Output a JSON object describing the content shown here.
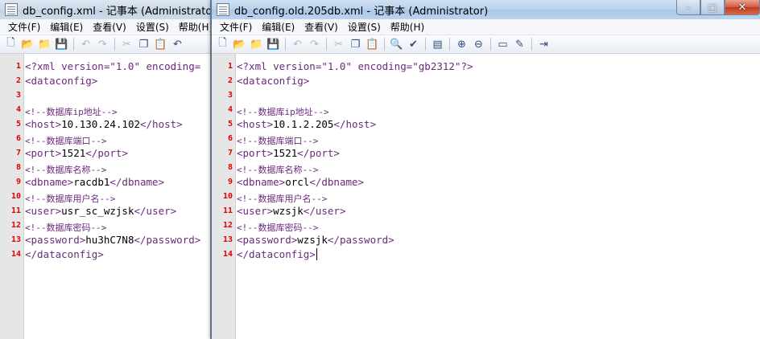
{
  "left_window": {
    "title": "db_config.xml - 记事本 (Administrator)",
    "menu": [
      "文件(F)",
      "编辑(E)",
      "查看(V)",
      "设置(S)",
      "帮助(H)"
    ],
    "lines": [
      {
        "n": "1",
        "kind": "pi",
        "text": "<?xml version=\"1.0\" encoding="
      },
      {
        "n": "2",
        "kind": "tag",
        "text": "<dataconfig>"
      },
      {
        "n": "3",
        "kind": "blank",
        "text": ""
      },
      {
        "n": "4",
        "kind": "comment",
        "text": "<!--数据库ip地址-->"
      },
      {
        "n": "5",
        "kind": "elem",
        "open": "<host>",
        "value": "10.130.24.102",
        "close": "</host>"
      },
      {
        "n": "6",
        "kind": "comment",
        "text": "<!--数据库端口-->"
      },
      {
        "n": "7",
        "kind": "elem",
        "open": "<port>",
        "value": "1521",
        "close": "</port>"
      },
      {
        "n": "8",
        "kind": "comment",
        "text": "<!--数据库名称-->"
      },
      {
        "n": "9",
        "kind": "elem",
        "open": "<dbname>",
        "value": "racdb1",
        "close": "</dbname>"
      },
      {
        "n": "10",
        "kind": "comment",
        "text": "<!--数据库用户名-->"
      },
      {
        "n": "11",
        "kind": "elem",
        "open": "<user>",
        "value": "usr_sc_wzjsk",
        "close": "</user>"
      },
      {
        "n": "12",
        "kind": "comment",
        "text": "<!--数据库密码-->"
      },
      {
        "n": "13",
        "kind": "elem",
        "open": "<password>",
        "value": "hu3hC7N8",
        "close": "</password>"
      },
      {
        "n": "14",
        "kind": "tag",
        "text": "</dataconfig>"
      }
    ]
  },
  "right_window": {
    "title": "db_config.old.205db.xml - 记事本 (Administrator)",
    "menu": [
      "文件(F)",
      "编辑(E)",
      "查看(V)",
      "设置(S)",
      "帮助(H)"
    ],
    "controls": {
      "minimize": "–",
      "maximize": "□",
      "close": "✕"
    },
    "lines": [
      {
        "n": "1",
        "kind": "pi",
        "text": "<?xml version=\"1.0\" encoding=\"gb2312\"?>"
      },
      {
        "n": "2",
        "kind": "tag",
        "text": "<dataconfig>"
      },
      {
        "n": "3",
        "kind": "blank",
        "text": ""
      },
      {
        "n": "4",
        "kind": "comment",
        "text": "<!--数据库ip地址-->"
      },
      {
        "n": "5",
        "kind": "elem",
        "open": "<host>",
        "value": "10.1.2.205",
        "close": "</host>"
      },
      {
        "n": "6",
        "kind": "comment",
        "text": "<!--数据库端口-->"
      },
      {
        "n": "7",
        "kind": "elem",
        "open": "<port>",
        "value": "1521",
        "close": "</port>"
      },
      {
        "n": "8",
        "kind": "comment",
        "text": "<!--数据库名称-->"
      },
      {
        "n": "9",
        "kind": "elem",
        "open": "<dbname>",
        "value": "orcl",
        "close": "</dbname>"
      },
      {
        "n": "10",
        "kind": "comment",
        "text": "<!--数据库用户名-->"
      },
      {
        "n": "11",
        "kind": "elem",
        "open": "<user>",
        "value": "wzsjk",
        "close": "</user>"
      },
      {
        "n": "12",
        "kind": "comment",
        "text": "<!--数据库密码-->"
      },
      {
        "n": "13",
        "kind": "elem",
        "open": "<password>",
        "value": "wzsjk",
        "close": "</password>"
      },
      {
        "n": "14",
        "kind": "tag",
        "text": "</dataconfig>"
      }
    ]
  },
  "toolbar_icons": [
    "new-file-icon",
    "open-folder-icon",
    "open-recent-icon",
    "save-icon",
    "undo-icon",
    "redo-icon",
    "cut-icon",
    "copy-icon",
    "paste-icon",
    "find-icon",
    "spell-check-icon",
    "insert-icon",
    "zoom-in-icon",
    "zoom-out-icon",
    "window-icon",
    "edit-icon",
    "exit-icon"
  ],
  "colors": {
    "line_number": "#e00000",
    "tag": "#6a2a7a",
    "gutter": "#e6e6e6"
  }
}
